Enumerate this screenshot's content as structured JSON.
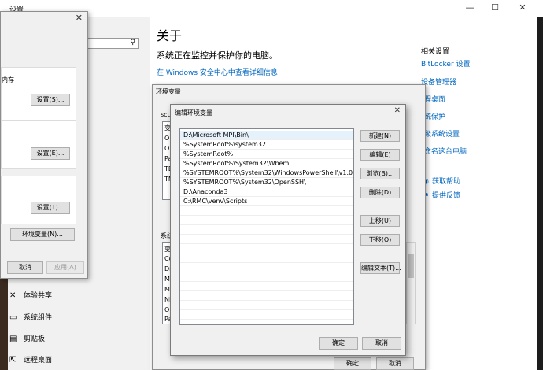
{
  "settings": {
    "window_title": "设置",
    "about_title": "关于",
    "about_subtitle": "系统正在监控并保护你的电脑。",
    "security_link": "在 Windows 安全中心中查看详细信息",
    "related_heading": "相关设置",
    "related_links": [
      "BitLocker 设置",
      "设备管理器",
      "远程桌面",
      "系统保护",
      "高级系统设置",
      "重命名这台电脑"
    ],
    "help_links": [
      "获取帮助",
      "提供反馈"
    ],
    "nav_items": [
      "体验共享",
      "系统组件",
      "剪贴板",
      "远程桌面"
    ]
  },
  "sysprops": {
    "partial_text": "内存",
    "settings_btn_1": "设置(S)...",
    "settings_btn_2": "设置(E)...",
    "settings_btn_3": "设置(T)...",
    "env_btn": "环境变量(N)...",
    "cancel": "取消",
    "apply": "应用(A)"
  },
  "envvars": {
    "title": "环境变量",
    "user_group_label": "scut",
    "user_header": "变",
    "user_rows": [
      "O",
      "O",
      "Pa",
      "TE",
      "TM"
    ],
    "system_group_label": "系统",
    "system_header": "变",
    "system_rows": [
      "Co",
      "Dr",
      "M",
      "M",
      "NI",
      "O",
      "Pa"
    ],
    "ok": "确定",
    "cancel": "取消"
  },
  "edit_env": {
    "title": "编辑环境变量",
    "paths": [
      "D:\\Microsoft MPI\\Bin\\",
      "%SystemRoot%\\system32",
      "%SystemRoot%",
      "%SystemRoot%\\System32\\Wbem",
      "%SYSTEMROOT%\\System32\\WindowsPowerShell\\v1.0\\",
      "%SYSTEMROOT%\\System32\\OpenSSH\\",
      "D:\\Anaconda3",
      "C:\\RMC\\venv\\Scripts"
    ],
    "buttons": {
      "new": "新建(N)",
      "edit": "编辑(E)",
      "browse": "浏览(B)...",
      "delete": "删除(D)",
      "move_up": "上移(U)",
      "move_down": "下移(O)",
      "edit_text": "编辑文本(T)..."
    },
    "ok": "确定",
    "cancel": "取消"
  }
}
